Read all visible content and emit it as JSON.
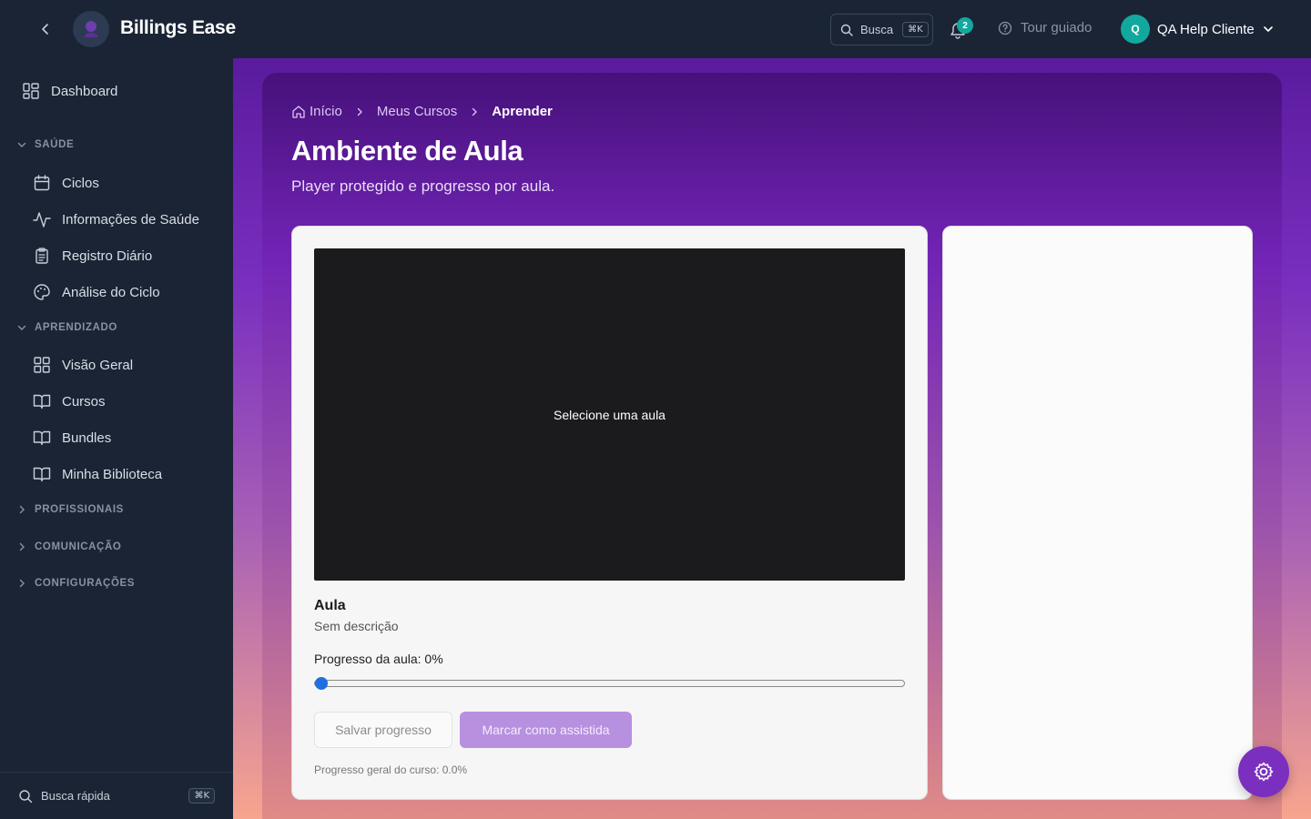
{
  "header": {
    "brand": "Billings Ease",
    "search_label": "Busca",
    "search_shortcut": "⌘K",
    "notifications_count": "2",
    "tour_label": "Tour guiado",
    "user_initial": "Q",
    "user_name": "QA Help Cliente"
  },
  "sidebar": {
    "dashboard": "Dashboard",
    "sections": [
      {
        "label": "SAÚDE",
        "expanded": true,
        "items": [
          "Ciclos",
          "Informações de Saúde",
          "Registro Diário",
          "Análise do Ciclo"
        ]
      },
      {
        "label": "APRENDIZADO",
        "expanded": true,
        "items": [
          "Visão Geral",
          "Cursos",
          "Bundles",
          "Minha Biblioteca"
        ]
      },
      {
        "label": "PROFISSIONAIS",
        "expanded": false
      },
      {
        "label": "COMUNICAÇÃO",
        "expanded": false
      },
      {
        "label": "CONFIGURAÇÕES",
        "expanded": false
      }
    ],
    "quick_search": "Busca rápida",
    "quick_search_shortcut": "⌘K"
  },
  "breadcrumb": [
    "Início",
    "Meus Cursos",
    "Aprender"
  ],
  "page": {
    "title": "Ambiente de Aula",
    "subtitle": "Player protegido e progresso por aula."
  },
  "player": {
    "placeholder": "Selecione uma aula",
    "lesson_title": "Aula",
    "lesson_description": "Sem descrição",
    "progress_label": "Progresso da aula: 0%",
    "progress_value": 0,
    "save_button": "Salvar progresso",
    "mark_button": "Marcar como assistida",
    "course_progress": "Progresso geral do curso: 0.0%"
  },
  "colors": {
    "sidebar_bg": "#1b2435",
    "accent": "#7a2fbf",
    "teal": "#13a89e",
    "slider": "#1f6fe0"
  }
}
